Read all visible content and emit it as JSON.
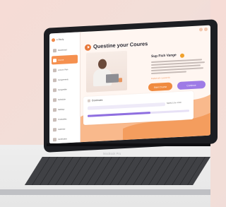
{
  "app": {
    "title": "Questine your Coures",
    "sidebar": {
      "logo_label": "e-Study",
      "items": [
        {
          "label": "Dashboard",
          "active": false
        },
        {
          "label": "Course",
          "active": true
        },
        {
          "label": "Lesson Plan",
          "active": false
        },
        {
          "label": "Assignments",
          "active": false
        },
        {
          "label": "Assignable",
          "active": false
        },
        {
          "label": "Schedule",
          "active": false
        },
        {
          "label": "Settings",
          "active": false
        },
        {
          "label": "Timetables",
          "active": false
        },
        {
          "label": "Calendar",
          "active": false
        },
        {
          "label": "Certificates",
          "active": false
        }
      ]
    },
    "info": {
      "name": "Sup Fich Vange",
      "link": "Explore all  •  Lesson 03"
    },
    "buttons": {
      "start": "Start Course",
      "continue": "Continue"
    },
    "panel": {
      "label": "Continues",
      "speed": "Speed 1.0x  •  0:50"
    },
    "progress": 0.62
  },
  "device": {
    "brand_label": "MacBook Pro"
  },
  "colors": {
    "accent_orange": "#f08a3f",
    "accent_purple": "#9e7be6",
    "screen_bg": "#fff6f1"
  }
}
